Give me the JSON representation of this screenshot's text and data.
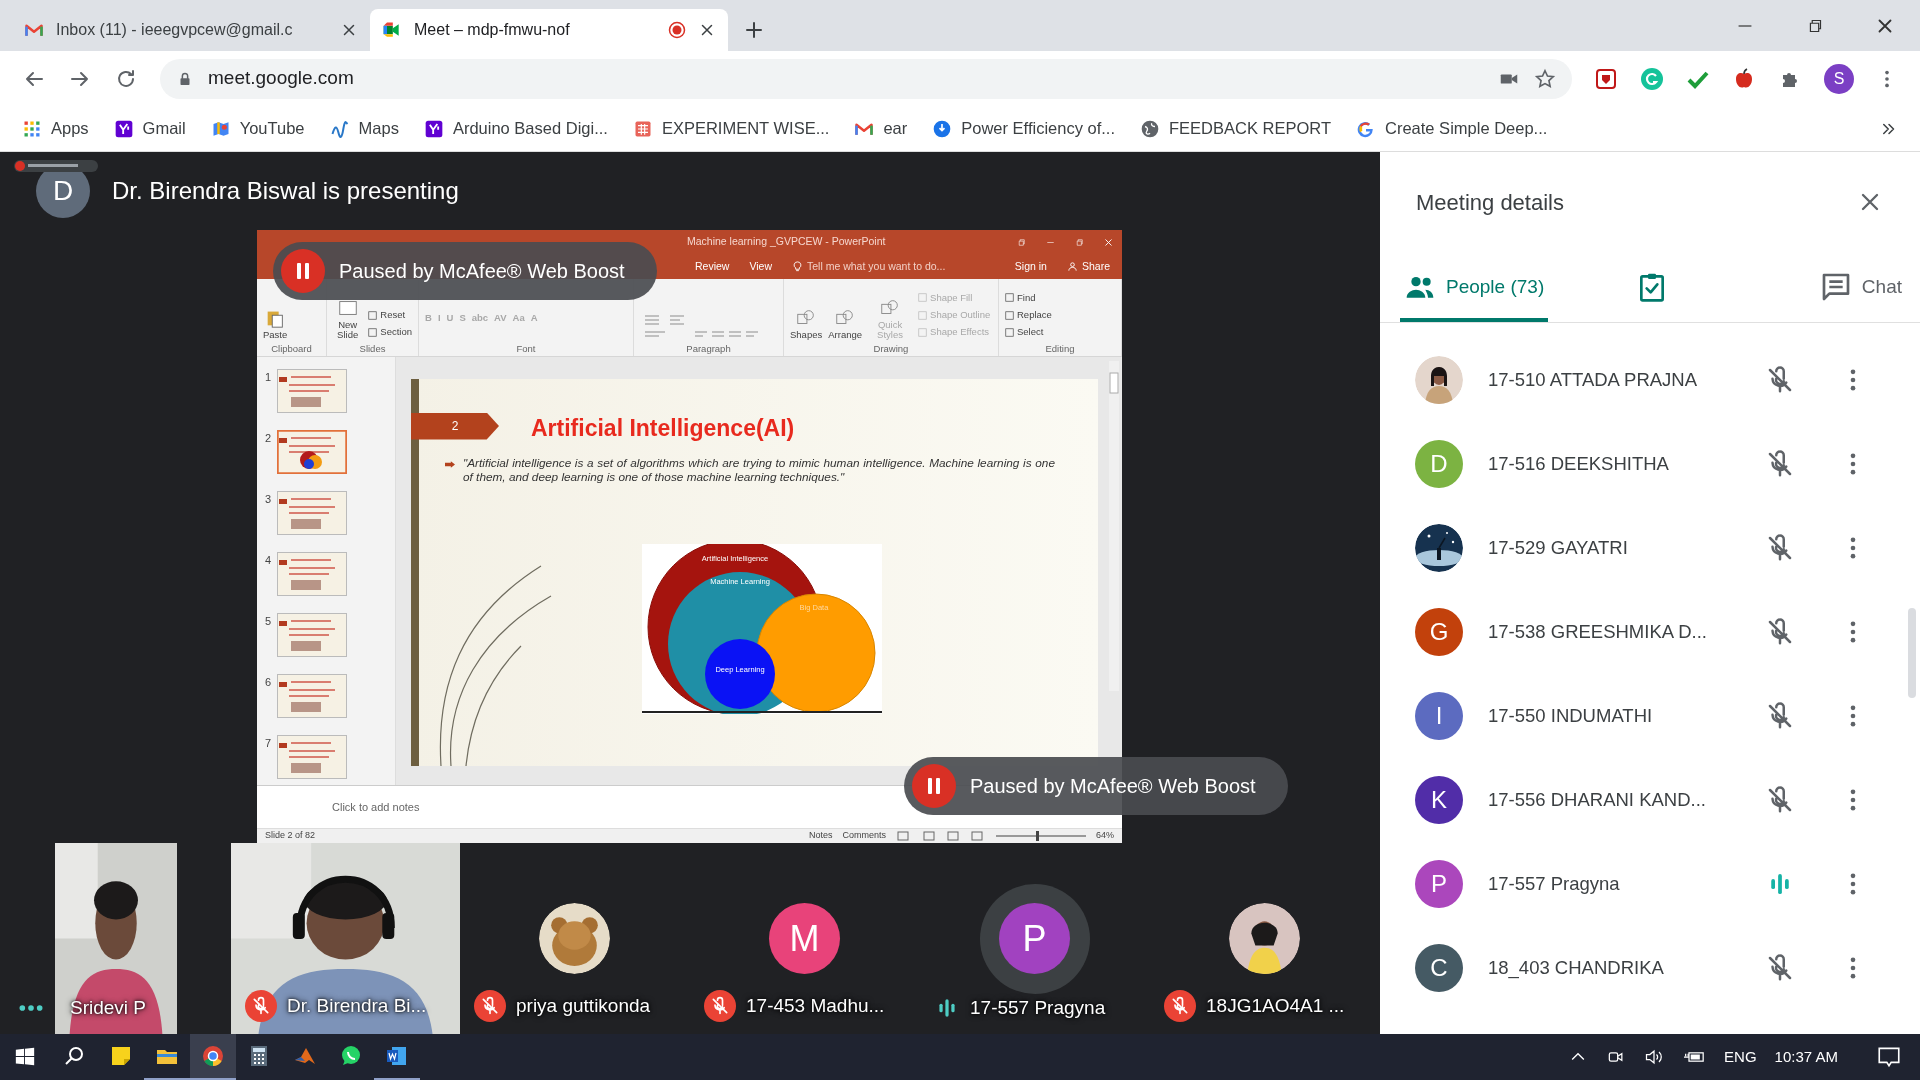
{
  "browser": {
    "tabs": [
      {
        "title": "Inbox (11) - ieeegvpcew@gmail.c",
        "kind": "gmail",
        "selected": false,
        "recording": false
      },
      {
        "title": "Meet – mdp-fmwu-nof",
        "kind": "meet",
        "selected": true,
        "recording": true
      }
    ],
    "url": "meet.google.com",
    "profile_initial": "S",
    "bookmarks": [
      {
        "label": "Apps",
        "kind": "apps"
      },
      {
        "label": "Gmail",
        "kind": "yahoo"
      },
      {
        "label": "YouTube",
        "kind": "map"
      },
      {
        "label": "Maps",
        "kind": "iirs"
      },
      {
        "label": "Arduino Based Digi...",
        "kind": "yahoo"
      },
      {
        "label": "EXPERIMENT WISE...",
        "kind": "sheet"
      },
      {
        "label": "ear",
        "kind": "gmail"
      },
      {
        "label": "Power Efficiency of...",
        "kind": "pin"
      },
      {
        "label": "FEEDBACK REPORT",
        "kind": "globe"
      },
      {
        "label": "Create Simple Deep...",
        "kind": "google"
      }
    ]
  },
  "meet": {
    "presenter": {
      "initial": "D",
      "text": "Dr. Birendra Biswal is presenting"
    },
    "overlays": [
      "Paused by McAfee® Web Boost",
      "Paused by McAfee® Web Boost"
    ],
    "powerpoint": {
      "title": "Machine learning _GVPCEW - PowerPoint",
      "menu_tabs": [
        "Review",
        "View"
      ],
      "tell_me": "Tell me what you want to do...",
      "sign_in": "Sign in",
      "share": "Share",
      "ribbon": [
        {
          "label": "Clipboard",
          "items": [
            {
              "label": "Paste",
              "kind": "large",
              "disabled": false
            }
          ]
        },
        {
          "label": "Slides",
          "items": [
            {
              "label": "New Slide",
              "kind": "large",
              "disabled": false
            },
            {
              "label": "Reset",
              "kind": "small",
              "disabled": false
            },
            {
              "label": "Section",
              "kind": "small",
              "disabled": false
            }
          ]
        },
        {
          "label": "Font",
          "items": [
            {
              "label": "B",
              "kind": "glyph",
              "disabled": true
            },
            {
              "label": "I",
              "kind": "glyph",
              "disabled": true
            },
            {
              "label": "U",
              "kind": "glyph",
              "disabled": true
            },
            {
              "label": "S",
              "kind": "glyph",
              "disabled": true
            },
            {
              "label": "abc",
              "kind": "glyph",
              "disabled": true
            },
            {
              "label": "AV",
              "kind": "glyph",
              "disabled": true
            },
            {
              "label": "Aa",
              "kind": "glyph",
              "disabled": true
            },
            {
              "label": "A",
              "kind": "glyph",
              "disabled": true
            }
          ]
        },
        {
          "label": "Paragraph"
        },
        {
          "label": "Drawing",
          "items": [
            {
              "label": "Shapes",
              "kind": "large",
              "disabled": false
            },
            {
              "label": "Arrange",
              "kind": "large",
              "disabled": false
            },
            {
              "label": "Quick Styles",
              "kind": "large",
              "disabled": true
            },
            {
              "label": "Shape Fill",
              "kind": "small",
              "disabled": true
            },
            {
              "label": "Shape Outline",
              "kind": "small",
              "disabled": true
            },
            {
              "label": "Shape Effects",
              "kind": "small",
              "disabled": true
            }
          ]
        },
        {
          "label": "Editing",
          "items": [
            {
              "label": "Find",
              "kind": "small",
              "disabled": false
            },
            {
              "label": "Replace",
              "kind": "small",
              "disabled": false
            },
            {
              "label": "Select",
              "kind": "small",
              "disabled": false
            }
          ]
        }
      ],
      "thumbnails": [
        {
          "number": "1",
          "selected": false
        },
        {
          "number": "2",
          "selected": true
        },
        {
          "number": "3",
          "selected": false
        },
        {
          "number": "4",
          "selected": false
        },
        {
          "number": "5",
          "selected": false
        },
        {
          "number": "6",
          "selected": false
        },
        {
          "number": "7",
          "selected": false
        }
      ],
      "slide": {
        "number": "2",
        "title": "Artificial Intelligence(AI)",
        "quote": "\"Artificial intelligence is a set of algorithms which are trying to mimic human intelligence. Machine learning is one of them, and deep learning is one of those machine learning techniques.\"",
        "venn": [
          "Artificial Intelligence",
          "Machine Learning",
          "Big Data",
          "Deep Learning"
        ]
      },
      "notes_placeholder": "Click to add notes",
      "status": {
        "slide": "Slide 2 of 82",
        "notes": "Notes",
        "comments": "Comments",
        "zoom": "64%",
        "zoom_slider": {
          "level": 0.45
        }
      }
    },
    "tiles": [
      {
        "name": "Sridevi P",
        "kind": "video",
        "muted": false,
        "speaking": false
      },
      {
        "name": "Dr. Birendra Bi...",
        "kind": "video",
        "muted": true,
        "speaking": false
      },
      {
        "name": "priya guttikonda",
        "muted": true,
        "speaking": false
      },
      {
        "name": "17-453 Madhu...",
        "kind": "letter",
        "initial": "M",
        "color": "#e8437a",
        "muted": true,
        "speaking": false
      },
      {
        "name": "17-557 Pragyna",
        "kind": "letter",
        "initial": "P",
        "color": "#a142c0",
        "muted": false,
        "speaking": true
      },
      {
        "name": "18JG1AO4A1 ...",
        "muted": true,
        "speaking": false
      }
    ]
  },
  "panel": {
    "title": "Meeting details",
    "tabs": [
      {
        "kind": "people",
        "label": "People (73)",
        "selected": true
      },
      {
        "kind": "activities",
        "selected": false
      },
      {
        "kind": "chat",
        "label": "Chat",
        "selected": false
      }
    ],
    "people": [
      {
        "name": "17-510 ATTADA PRAJNA",
        "muted": true
      },
      {
        "name": "17-516 DEEKSHITHA",
        "kind": "letter",
        "initial": "D",
        "color": "#7cb342",
        "muted": true
      },
      {
        "name": "17-529 GAYATRI",
        "muted": true
      },
      {
        "name": "17-538 GREESHMIKA D...",
        "kind": "letter",
        "initial": "G",
        "color": "#c2410c",
        "muted": true
      },
      {
        "name": "17-550 INDUMATHI",
        "kind": "letter",
        "initial": "I",
        "color": "#5c6bc0",
        "muted": true
      },
      {
        "name": "17-556 DHARANI KAND...",
        "kind": "letter",
        "initial": "K",
        "color": "#512da8",
        "muted": true
      },
      {
        "name": "17-557 Pragyna",
        "kind": "letter",
        "initial": "P",
        "color": "#ab47bc",
        "muted": false
      },
      {
        "name": "18_403 CHANDRIKA",
        "kind": "letter",
        "initial": "C",
        "color": "#455a64",
        "muted": true
      }
    ]
  },
  "taskbar": {
    "apps": [
      {
        "kind": "search",
        "open": false,
        "selected": false
      },
      {
        "kind": "sticky",
        "open": false,
        "selected": false
      },
      {
        "kind": "explorer",
        "open": true,
        "selected": false
      },
      {
        "kind": "chrome",
        "open": true,
        "selected": true
      },
      {
        "kind": "calculator",
        "open": false,
        "selected": false
      },
      {
        "kind": "matlab",
        "open": false,
        "selected": false
      },
      {
        "kind": "whatsapp",
        "open": false,
        "selected": false
      },
      {
        "kind": "word",
        "open": true,
        "selected": false
      }
    ],
    "language": "ENG",
    "time": "10:37 AM"
  }
}
